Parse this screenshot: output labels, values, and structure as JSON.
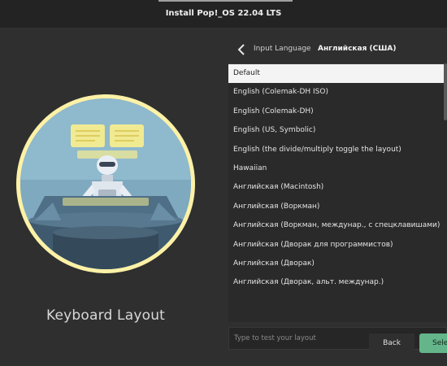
{
  "window": {
    "title": "Install Pop!_OS 22.04 LTS"
  },
  "left": {
    "title": "Keyboard Layout"
  },
  "header": {
    "label": "Input Language",
    "value": "Английская (США)"
  },
  "layouts": [
    "Default",
    "English (Colemak-DH ISO)",
    "English (Colemak-DH)",
    "English (US, Symbolic)",
    "English (the divide/multiply toggle the layout)",
    "Hawaiian",
    "Английская (Macintosh)",
    "Английская (Воркман)",
    "Английская (Воркман, междунар., с спецклавишами)",
    "Английская (Дворак для программистов)",
    "Английская (Дворак)",
    "Английская (Дворак, альт. междунар.)"
  ],
  "selected_index": 0,
  "test": {
    "placeholder": "Type to test your layout",
    "value": ""
  },
  "buttons": {
    "back": "Back",
    "select": "Select"
  },
  "colors": {
    "accent": "#64b58a",
    "background": "#2f2f2f",
    "ring": "#fcf1a6"
  }
}
